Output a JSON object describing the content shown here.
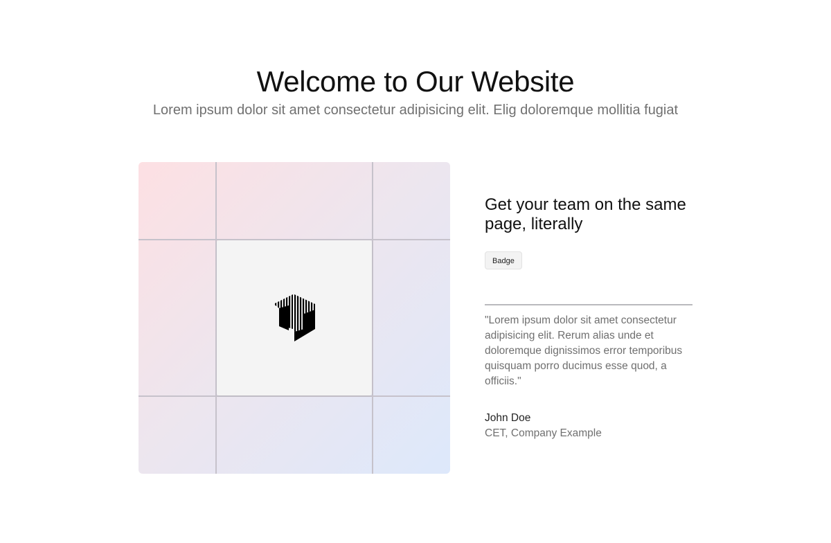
{
  "hero": {
    "title": "Welcome to Our Website",
    "subtitle": "Lorem ipsum dolor sit amet consectetur adipisicing elit. Elig doloremque mollitia fugiat"
  },
  "visual": {
    "logo_icon": "striped-cube-logo-icon",
    "gradient_colors": [
      "#fde0e3",
      "#ece6ef",
      "#dde8fb"
    ],
    "card_color": "#f4f4f4"
  },
  "feature": {
    "heading": "Get your team on the same page, literally",
    "badge": "Badge"
  },
  "testimonial": {
    "quote": "\"Lorem ipsum dolor sit amet consectetur adipisicing elit. Rerum alias unde et doloremque dignissimos error temporibus quisquam porro ducimus esse quod, a officiis.\"",
    "author_name": "John Doe",
    "author_role": "CET, Company Example"
  }
}
